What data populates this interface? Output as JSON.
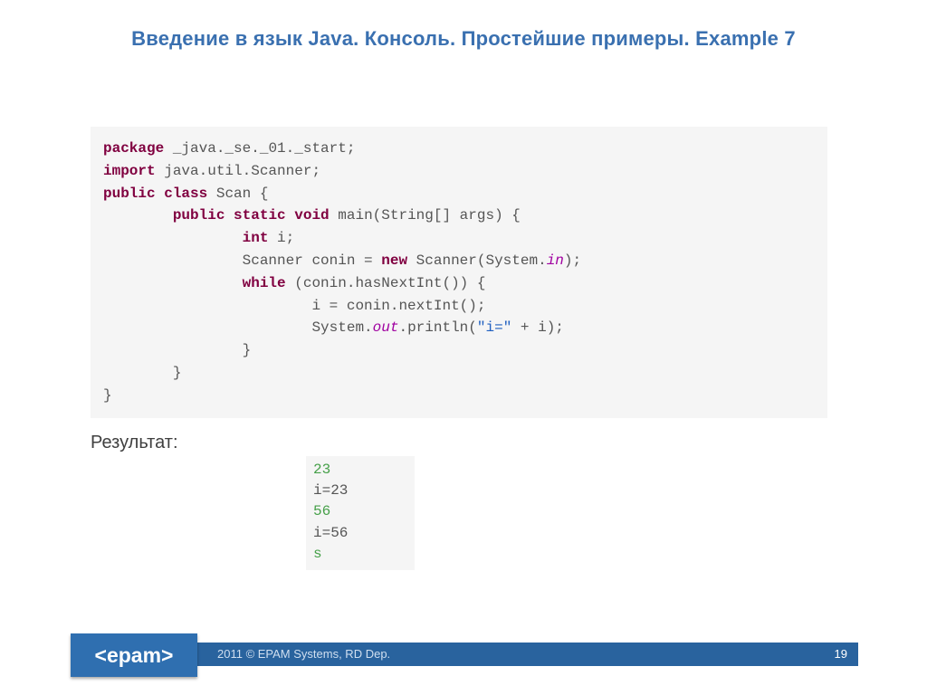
{
  "title": "Введение в язык Java. Консоль. Простейшие примеры. Example 7",
  "code": {
    "l1_kw": "package",
    "l1_rest": " _java._se._01._start;",
    "l2_kw": "import",
    "l2_rest": " java.util.Scanner;",
    "l3_kw1": "public",
    "l3_kw2": "class",
    "l3_rest": " Scan {",
    "l4_kw1": "public",
    "l4_kw2": "static",
    "l4_kw3": "void",
    "l4_rest": " main(String[] args) {",
    "l5_kw": "int",
    "l5_rest": " i;",
    "l6_a": "Scanner conin = ",
    "l6_kw": "new",
    "l6_b": " Scanner(System.",
    "l6_mod": "in",
    "l6_c": ");",
    "l7_kw": "while",
    "l7_rest": " (conin.hasNextInt()) {",
    "l8": "i = conin.nextInt();",
    "l9_a": "System.",
    "l9_mod": "out",
    "l9_b": ".println(",
    "l9_str": "\"i=\"",
    "l9_c": " + i);",
    "l10": "}",
    "l11": "}",
    "l12": "}"
  },
  "result_label": "Результат:",
  "result": {
    "r1": "23",
    "r2": "i=23",
    "r3": "56",
    "r4": "i=56",
    "r5": "s"
  },
  "footer": {
    "logo": "<epam>",
    "copyright": "2011 © EPAM Systems, RD Dep.",
    "page": "19"
  }
}
